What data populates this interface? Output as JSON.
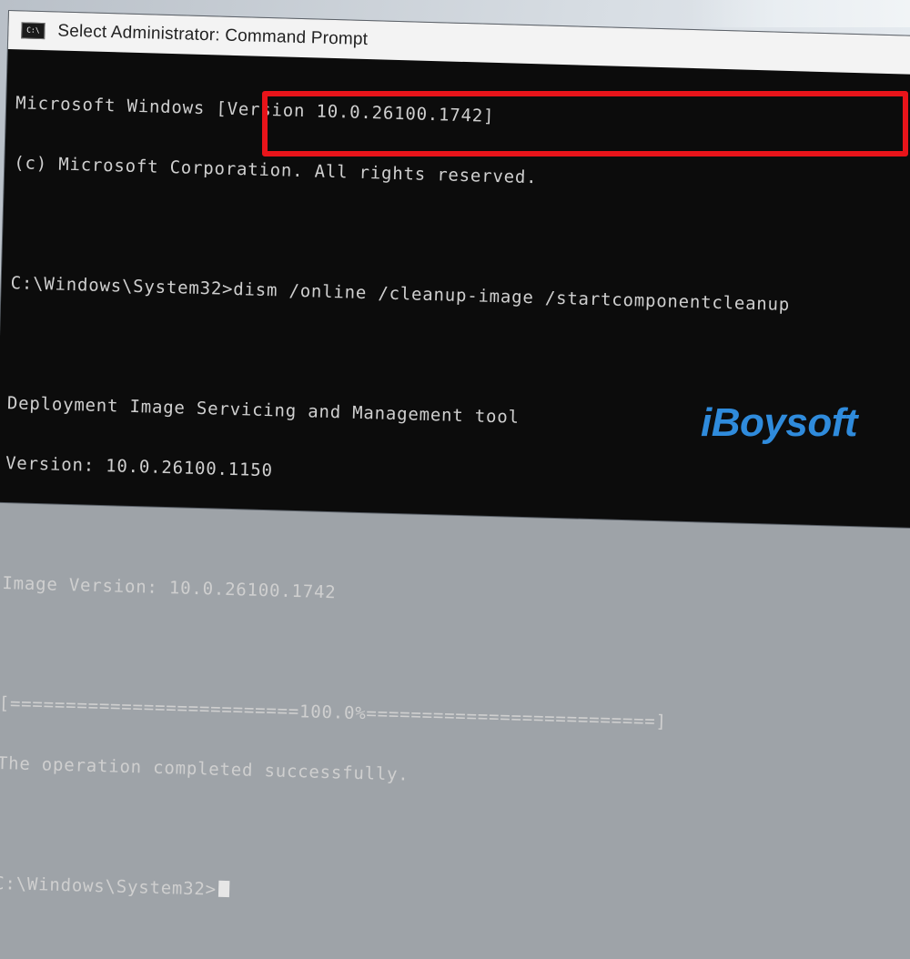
{
  "window": {
    "title": "Select Administrator: Command Prompt",
    "icon_name": "cmd-icon",
    "icon_glyph": "C:\\"
  },
  "console": {
    "lines": [
      "Microsoft Windows [Version 10.0.26100.1742]",
      "(c) Microsoft Corporation. All rights reserved.",
      "",
      "C:\\Windows\\System32>",
      "",
      "Deployment Image Servicing and Management tool",
      "Version: 10.0.26100.1150",
      "",
      "Image Version: 10.0.26100.1742",
      "",
      "[==========================100.0%==========================]",
      "The operation completed successfully.",
      "",
      "C:\\Windows\\System32>"
    ],
    "command": "dism /online /cleanup-image /startcomponentcleanup",
    "final_prompt": "C:\\Windows\\System32>",
    "progress_percent": 100.0
  },
  "annotation": {
    "highlight_color": "#e8141a"
  },
  "watermark": {
    "text": "iBoysoft",
    "color": "#2f8bdc"
  }
}
